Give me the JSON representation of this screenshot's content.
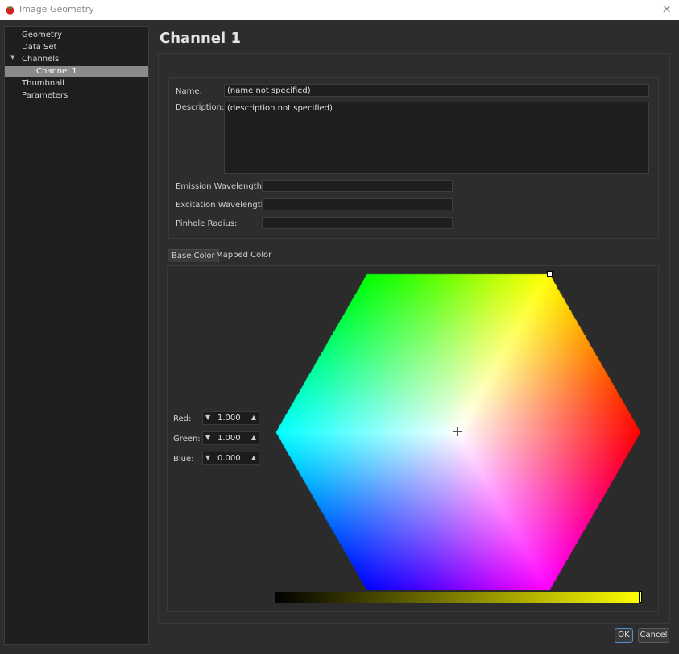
{
  "window": {
    "title": "Image Geometry",
    "close_glyph": "×",
    "icon": "tomato-icon"
  },
  "sidebar": {
    "items": [
      {
        "label": "Geometry"
      },
      {
        "label": "Data Set"
      },
      {
        "label": "Channels"
      },
      {
        "label": "Channel 1"
      },
      {
        "label": "Thumbnail"
      },
      {
        "label": "Parameters"
      }
    ],
    "selected": "Channel 1"
  },
  "page": {
    "title": "Channel 1"
  },
  "form": {
    "name_label": "Name:",
    "name_value": "(name not specified)",
    "description_label": "Description:",
    "description_value": "(description not specified)",
    "emission_label": "Emission Wavelength:",
    "emission_value": "",
    "excitation_label": "Excitation Wavelength:",
    "excitation_value": "",
    "pinhole_label": "Pinhole Radius:",
    "pinhole_value": ""
  },
  "tabs": [
    {
      "label": "Base Color",
      "active": true
    },
    {
      "label": "Mapped Color",
      "active": false
    }
  ],
  "color": {
    "red_label": "Red:",
    "red_value": "1.000",
    "green_label": "Green:",
    "green_value": "1.000",
    "blue_label": "Blue:",
    "blue_value": "0.000",
    "gradient_start": "#000000",
    "gradient_end": "#ffff00"
  },
  "buttons": {
    "ok": "OK",
    "cancel": "Cancel"
  }
}
